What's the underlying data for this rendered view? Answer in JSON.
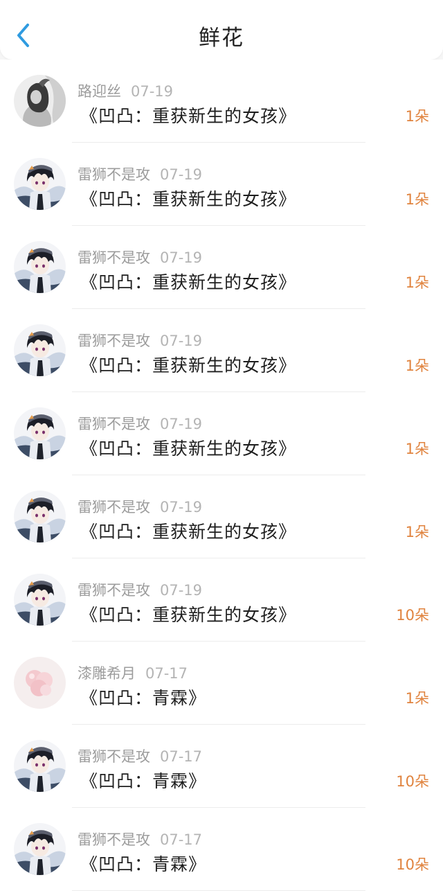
{
  "header": {
    "back_icon": "chevron-left-icon",
    "title": "鲜花",
    "accent_color": "#2f9be0"
  },
  "items": [
    {
      "user": "路迎丝",
      "date": "07-19",
      "book": "《凹凸：重获新生的女孩》",
      "count": "1朵",
      "avatar": "avatar-woman"
    },
    {
      "user": "雷狮不是攻",
      "date": "07-19",
      "book": "《凹凸：重获新生的女孩》",
      "count": "1朵",
      "avatar": "avatar-anime"
    },
    {
      "user": "雷狮不是攻",
      "date": "07-19",
      "book": "《凹凸：重获新生的女孩》",
      "count": "1朵",
      "avatar": "avatar-anime"
    },
    {
      "user": "雷狮不是攻",
      "date": "07-19",
      "book": "《凹凸：重获新生的女孩》",
      "count": "1朵",
      "avatar": "avatar-anime"
    },
    {
      "user": "雷狮不是攻",
      "date": "07-19",
      "book": "《凹凸：重获新生的女孩》",
      "count": "1朵",
      "avatar": "avatar-anime"
    },
    {
      "user": "雷狮不是攻",
      "date": "07-19",
      "book": "《凹凸：重获新生的女孩》",
      "count": "1朵",
      "avatar": "avatar-anime"
    },
    {
      "user": "雷狮不是攻",
      "date": "07-19",
      "book": "《凹凸：重获新生的女孩》",
      "count": "10朵",
      "avatar": "avatar-anime"
    },
    {
      "user": "漆雕希月",
      "date": "07-17",
      "book": "《凹凸：青霖》",
      "count": "1朵",
      "avatar": "avatar-pink-balloon"
    },
    {
      "user": "雷狮不是攻",
      "date": "07-17",
      "book": "《凹凸：青霖》",
      "count": "10朵",
      "avatar": "avatar-anime"
    },
    {
      "user": "雷狮不是攻",
      "date": "07-17",
      "book": "《凹凸：青霖》",
      "count": "10朵",
      "avatar": "avatar-anime"
    }
  ]
}
